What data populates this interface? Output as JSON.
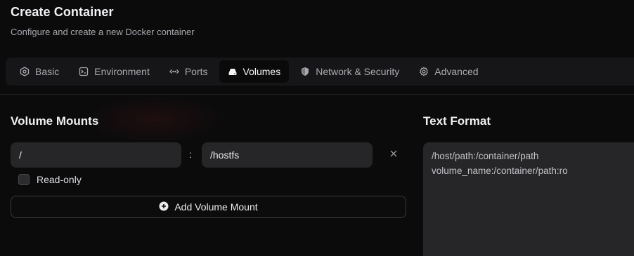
{
  "header": {
    "title": "Create Container",
    "subtitle": "Configure and create a new Docker container"
  },
  "tabs": [
    {
      "label": "Basic",
      "icon": "basic-icon",
      "active": false
    },
    {
      "label": "Environment",
      "icon": "environment-icon",
      "active": false
    },
    {
      "label": "Ports",
      "icon": "ports-icon",
      "active": false
    },
    {
      "label": "Volumes",
      "icon": "volumes-icon",
      "active": true
    },
    {
      "label": "Network & Security",
      "icon": "shield-icon",
      "active": false
    },
    {
      "label": "Advanced",
      "icon": "gear-icon",
      "active": false
    }
  ],
  "volume_mounts": {
    "title": "Volume Mounts",
    "mounts": [
      {
        "host_path": "/",
        "separator": ":",
        "container_path": "/hostfs",
        "read_only": false,
        "read_only_label": "Read-only"
      }
    ],
    "add_label": "Add Volume Mount"
  },
  "text_format": {
    "title": "Text Format",
    "placeholder_lines": [
      "/host/path:/container/path",
      "volume_name:/container/path:ro"
    ]
  },
  "colors": {
    "background": "#0b0b0c",
    "tabbar": "#161618",
    "active_tab": "#0a0a0b",
    "input": "#262628",
    "text": "#e8e8ea",
    "muted": "#a9a9b0"
  }
}
